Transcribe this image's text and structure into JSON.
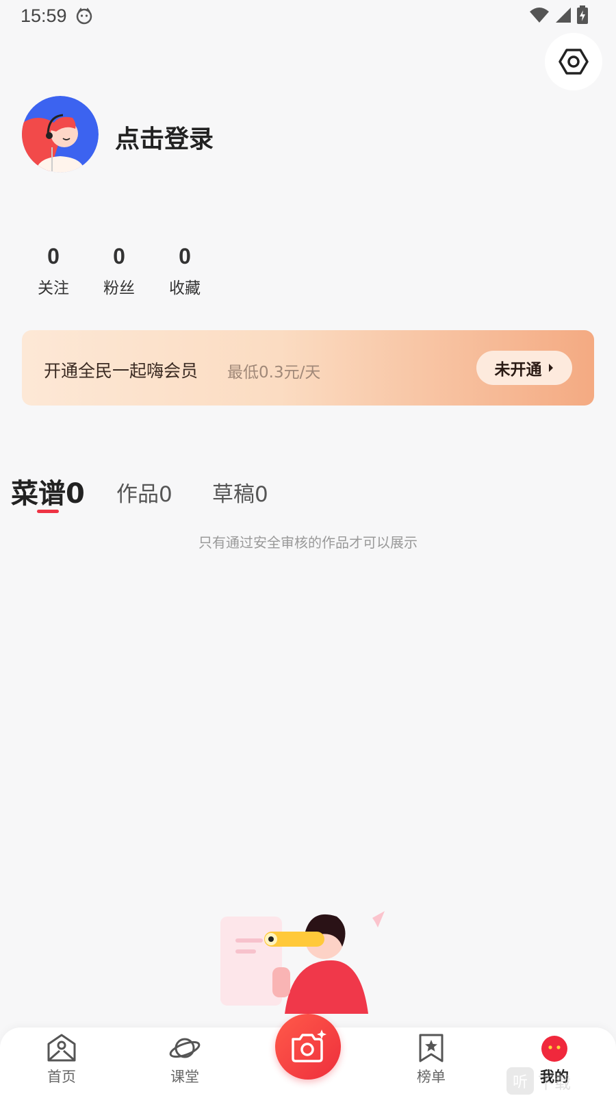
{
  "status_bar": {
    "time": "15:59"
  },
  "profile": {
    "login_prompt": "点击登录"
  },
  "stats": [
    {
      "value": "0",
      "label": "关注"
    },
    {
      "value": "0",
      "label": "粉丝"
    },
    {
      "value": "0",
      "label": "收藏"
    }
  ],
  "vip": {
    "title": "开通全民一起嗨会员",
    "subtitle": "最低0.3元/天",
    "status_button": "未开通"
  },
  "tabs": [
    {
      "label": "菜谱0",
      "active": true
    },
    {
      "label": "作品0",
      "active": false
    },
    {
      "label": "草稿0",
      "active": false
    }
  ],
  "notice": "只有通过安全审核的作品才可以展示",
  "bottom_nav": [
    {
      "label": "首页",
      "icon": "home-icon"
    },
    {
      "label": "课堂",
      "icon": "planet-icon"
    },
    {
      "label": "",
      "icon": "camera-icon"
    },
    {
      "label": "榜单",
      "icon": "bookmark-star-icon"
    },
    {
      "label": "我的",
      "icon": "profile-icon",
      "active": true
    }
  ],
  "watermark": {
    "badge": "听",
    "text": "下载"
  },
  "colors": {
    "accent": "#ee3344",
    "vip_start": "#fde8d6",
    "vip_end": "#f4aa82"
  }
}
